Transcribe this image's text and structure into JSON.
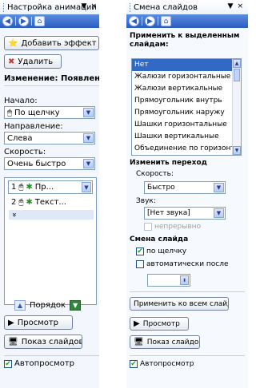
{
  "left": {
    "title": "Настройка анимации",
    "close": "×",
    "menu_arrow": "▼",
    "nav": [
      "back-icon",
      "forward-icon",
      "home-icon"
    ],
    "add_effect": "Добавить эффект",
    "delete": "Удалить",
    "change_heading": "Изменение: Появление",
    "start_label": "Начало:",
    "start_value": "По щелчку",
    "direction_label": "Направление:",
    "direction_value": "Слева",
    "speed_label": "Скорость:",
    "speed_value": "Очень быстро",
    "effects": [
      {
        "num": "1",
        "text": "Пр..."
      },
      {
        "num": "2",
        "text": "Текст..."
      }
    ],
    "expand": "»",
    "order_label": "Порядок",
    "preview": "Просмотр",
    "slideshow": "Показ слайдов",
    "autopreview": "Автопросмотр"
  },
  "right": {
    "title": "Смена слайдов",
    "close": "×",
    "menu_arrow": "▼",
    "apply_selected_heading": "Применить к выделенным слайдам:",
    "transitions": [
      "Нет",
      "Жалюзи горизонтальные",
      "Жалюзи вертикальные",
      "Прямоугольник внутрь",
      "Прямоугольник наружу",
      "Шашки горизонтальные",
      "Шашки вертикальные",
      "Объединение по горизонт..."
    ],
    "selected_transition": 0,
    "change_heading": "Изменить переход",
    "speed_label": "Скорость:",
    "speed_value": "Быстро",
    "sound_label": "Звук:",
    "sound_value": "[Нет звука]",
    "loop_label": "непрерывно",
    "advance_heading": "Смена слайда",
    "on_click_label": "по щелчку",
    "on_click_checked": true,
    "auto_label": "автоматически после",
    "auto_checked": false,
    "apply_all": "Применить ко всем слайдам",
    "preview": "Просмотр",
    "slideshow": "Показ слайдов",
    "autopreview": "Автопросмотр"
  }
}
